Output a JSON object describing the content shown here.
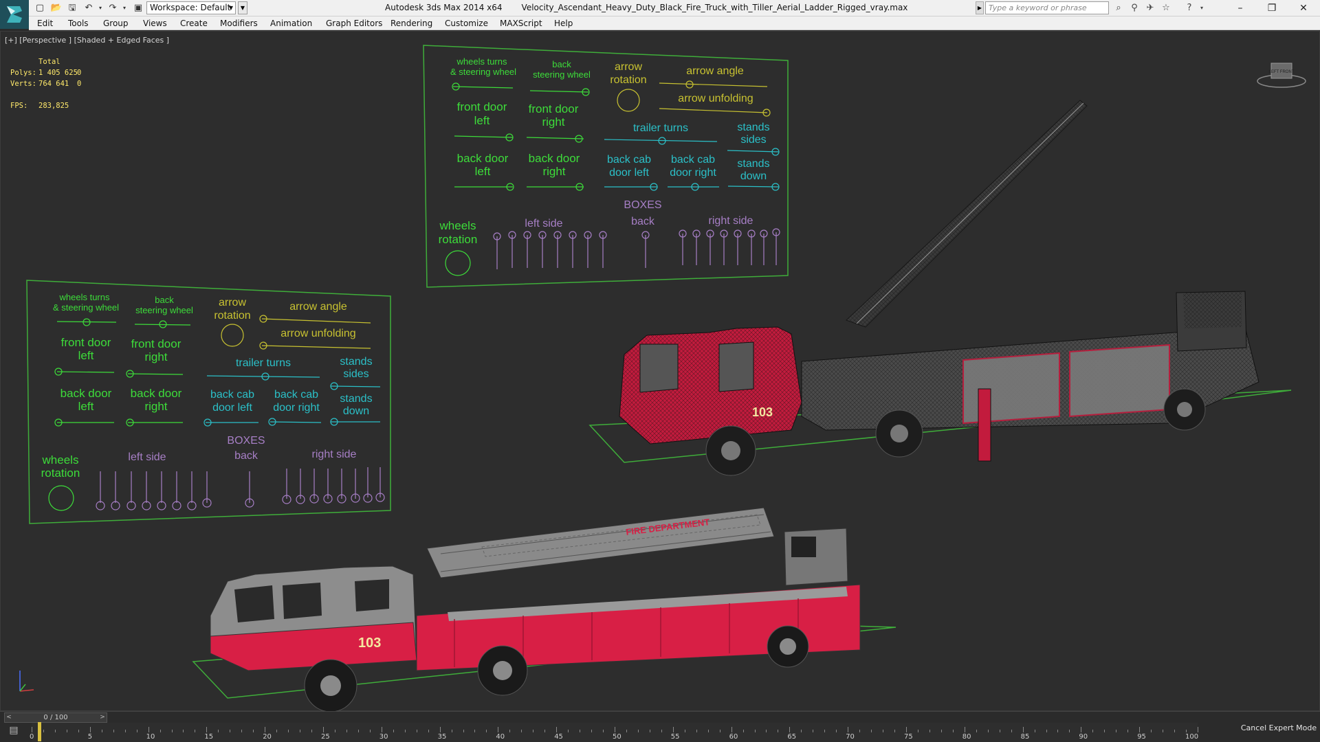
{
  "titlebar": {
    "workspace": "Workspace: Default",
    "app_name": "Autodesk 3ds Max  2014 x64",
    "file_name": "Velocity_Ascendant_Heavy_Duty_Black_Fire_Truck_with_Tiller_Aerial_Ladder_Rigged_vray.max",
    "search_placeholder": "Type a keyword or phrase"
  },
  "menu": [
    "Edit",
    "Tools",
    "Group",
    "Views",
    "Create",
    "Modifiers",
    "Animation",
    "Graph Editors",
    "Rendering",
    "Customize",
    "MAXScript",
    "Help"
  ],
  "viewport": {
    "label": "[+] [Perspective ] [Shaded + Edged Faces ]",
    "stats": {
      "header": "Total",
      "polys_label": "Polys:",
      "polys_total": "1 405 625",
      "polys_sel": "0",
      "verts_label": "Verts:",
      "verts_total": "764 641",
      "verts_sel": "0",
      "fps_label": "FPS:",
      "fps_value": "283,825"
    },
    "viewcube_label": "LEFT FRONT"
  },
  "control_panel": {
    "wheels_turns": [
      "wheels turns",
      "& steering wheel"
    ],
    "back_steering": [
      "back",
      "steering wheel"
    ],
    "arrow_rotation": [
      "arrow",
      "rotation"
    ],
    "arrow_angle": "arrow angle",
    "arrow_unfolding": "arrow unfolding",
    "front_door_left": [
      "front door",
      "left"
    ],
    "front_door_right": [
      "front door",
      "right"
    ],
    "trailer_turns": "trailer turns",
    "stands_sides": [
      "stands",
      "sides"
    ],
    "back_door_left": [
      "back door",
      "left"
    ],
    "back_door_right": [
      "back door",
      "right"
    ],
    "back_cab_door_left": [
      "back cab",
      "door left"
    ],
    "back_cab_door_right": [
      "back cab",
      "door right"
    ],
    "stands_down": [
      "stands",
      "down"
    ],
    "boxes": "BOXES",
    "wheels_rotation": [
      "wheels",
      "rotation"
    ],
    "left_side": "left side",
    "back": "back",
    "right_side": "right side"
  },
  "truck": {
    "unit_number": "103",
    "ladder_text": "FIRE DEPARTMENT"
  },
  "colors": {
    "green": "#3ddc3a",
    "yellow": "#c8c231",
    "cyan": "#2bc0c8",
    "purple": "#a77fc6",
    "gizmo_green": "#3fae3a",
    "truck_red": "#d81f45"
  },
  "timeline": {
    "frame_label": "0 / 100",
    "ticks": [
      "0",
      "5",
      "10",
      "15",
      "20",
      "25",
      "30",
      "35",
      "40",
      "45",
      "50",
      "55",
      "60",
      "65",
      "70",
      "75",
      "80",
      "85",
      "90",
      "95",
      "100"
    ],
    "expert_mode": "Cancel Expert Mode"
  }
}
